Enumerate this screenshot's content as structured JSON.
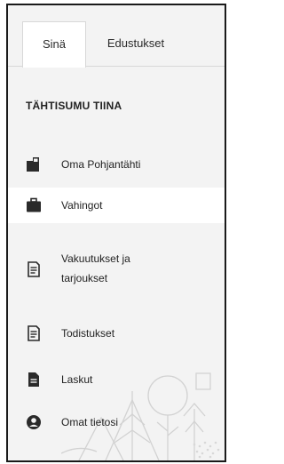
{
  "tabs": [
    {
      "label": "Sinä"
    },
    {
      "label": "Edustukset"
    }
  ],
  "user": {
    "name": "TÄHTISUMU TIINA"
  },
  "nav": [
    {
      "label": "Oma Pohjantähti",
      "icon": "door-icon"
    },
    {
      "label": "Vahingot",
      "icon": "briefcase-icon"
    },
    {
      "label": "Vakuutukset ja tarjoukset",
      "icon": "document-icon"
    },
    {
      "label": "Todistukset",
      "icon": "document-icon"
    },
    {
      "label": "Laskut",
      "icon": "invoice-icon"
    },
    {
      "label": "Omat tietosi",
      "icon": "user-icon"
    }
  ],
  "active_item": "Vahingot"
}
